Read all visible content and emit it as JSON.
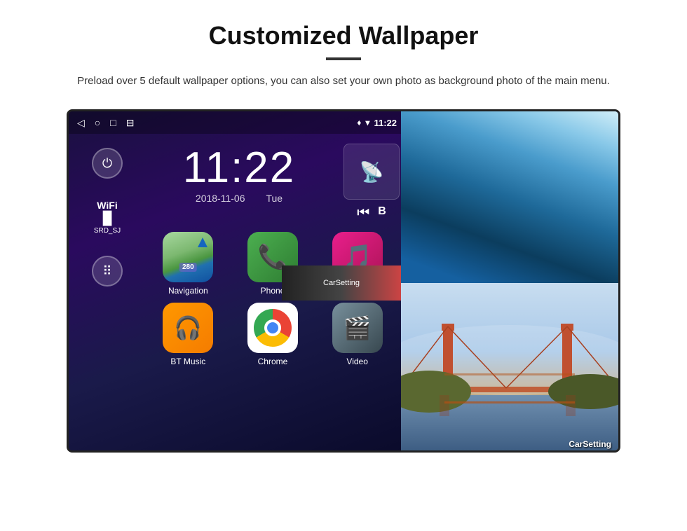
{
  "header": {
    "title": "Customized Wallpaper",
    "description": "Preload over 5 default wallpaper options, you can also set your own photo as background photo of the main menu."
  },
  "device": {
    "status_bar": {
      "nav_icons": [
        "◁",
        "○",
        "□",
        "⊟"
      ],
      "right_icons": [
        "♦",
        "▾"
      ],
      "time": "11:22"
    },
    "clock": {
      "time": "11:22",
      "date": "2018-11-06",
      "day": "Tue"
    },
    "sidebar": {
      "wifi_label": "WiFi",
      "wifi_name": "SRD_SJ"
    },
    "apps": [
      {
        "id": "navigation",
        "label": "Navigation",
        "road": "280"
      },
      {
        "id": "phone",
        "label": "Phone"
      },
      {
        "id": "music",
        "label": "Music"
      },
      {
        "id": "btmusic",
        "label": "BT Music"
      },
      {
        "id": "chrome",
        "label": "Chrome"
      },
      {
        "id": "video",
        "label": "Video"
      }
    ]
  },
  "wallpapers": [
    {
      "id": "ice-cave",
      "label": "Ice Cave"
    },
    {
      "id": "bridge",
      "label": "Golden Gate Bridge"
    }
  ]
}
